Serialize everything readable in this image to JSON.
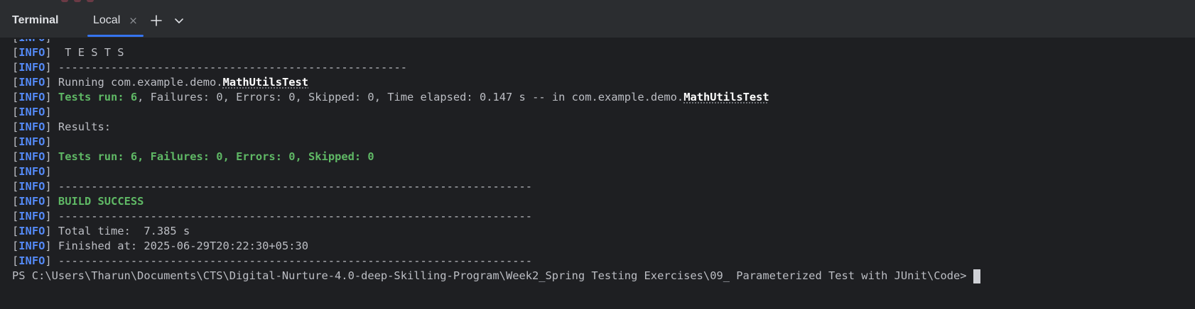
{
  "tool_window": {
    "title": "Terminal"
  },
  "tabs": [
    {
      "label": "Local",
      "active": true,
      "close_glyph": "×"
    }
  ],
  "toolbar": {
    "new_tab_icon": "plus-icon",
    "dropdown_icon": "chevron-down-icon"
  },
  "colors": {
    "background": "#1e1f22",
    "tabbar": "#2b2d30",
    "accent": "#3574f0",
    "info_tag": "#548af7",
    "success_green": "#5fb865",
    "default_text": "#bcbec4"
  },
  "terminal": {
    "lines": [
      {
        "tag": "INFO",
        "parts": [
          {
            "text": " -----------------------------------------------------",
            "style": "plain"
          }
        ]
      },
      {
        "tag": "INFO",
        "parts": [
          {
            "text": "  T E S T S",
            "style": "plain"
          }
        ]
      },
      {
        "tag": "INFO",
        "parts": [
          {
            "text": " -----------------------------------------------------",
            "style": "plain"
          }
        ]
      },
      {
        "tag": "INFO",
        "parts": [
          {
            "text": " Running com.example.demo.",
            "style": "plain"
          },
          {
            "text": "MathUtilsTest",
            "style": "class"
          }
        ]
      },
      {
        "tag": "INFO",
        "parts": [
          {
            "text": " ",
            "style": "plain"
          },
          {
            "text": "Tests run: 6",
            "style": "green"
          },
          {
            "text": ", Failures: 0, Errors: 0, Skipped: 0, Time elapsed: 0.147 s -- in com.example.demo.",
            "style": "plain"
          },
          {
            "text": "MathUtilsTest",
            "style": "class"
          }
        ]
      },
      {
        "tag": "INFO",
        "parts": []
      },
      {
        "tag": "INFO",
        "parts": [
          {
            "text": " Results:",
            "style": "plain"
          }
        ]
      },
      {
        "tag": "INFO",
        "parts": []
      },
      {
        "tag": "INFO",
        "parts": [
          {
            "text": " ",
            "style": "plain"
          },
          {
            "text": "Tests run: 6, Failures: 0, Errors: 0, Skipped: 0",
            "style": "green"
          }
        ]
      },
      {
        "tag": "INFO",
        "parts": []
      },
      {
        "tag": "INFO",
        "parts": [
          {
            "text": " ------------------------------------------------------------------------",
            "style": "plain"
          }
        ]
      },
      {
        "tag": "INFO",
        "parts": [
          {
            "text": " ",
            "style": "plain"
          },
          {
            "text": "BUILD SUCCESS",
            "style": "green"
          }
        ]
      },
      {
        "tag": "INFO",
        "parts": [
          {
            "text": " ------------------------------------------------------------------------",
            "style": "plain"
          }
        ]
      },
      {
        "tag": "INFO",
        "parts": [
          {
            "text": " Total time:  7.385 s",
            "style": "plain"
          }
        ]
      },
      {
        "tag": "INFO",
        "parts": [
          {
            "text": " Finished at: 2025-06-29T20:22:30+05:30",
            "style": "plain"
          }
        ]
      },
      {
        "tag": "INFO",
        "parts": [
          {
            "text": " ------------------------------------------------------------------------",
            "style": "plain"
          }
        ]
      }
    ],
    "prompt": "PS C:\\Users\\Tharun\\Documents\\CTS\\Digital-Nurture-4.0-deep-Skilling-Program\\Week2_Spring Testing Exercises\\09_ Parameterized Test with JUnit\\Code>"
  }
}
